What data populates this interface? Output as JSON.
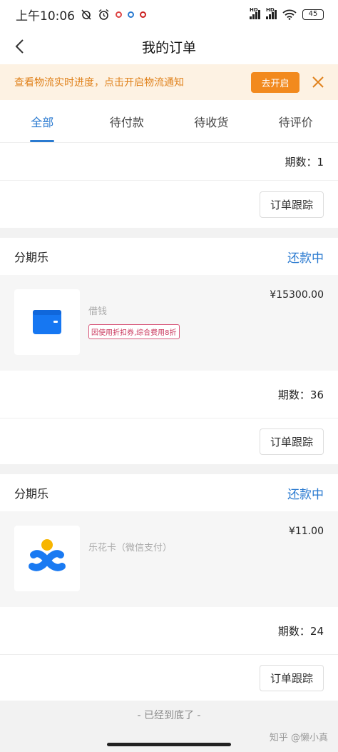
{
  "status_bar": {
    "time": "上午10:06",
    "battery": "45",
    "signal_badges": [
      "HD",
      "HD"
    ]
  },
  "nav": {
    "title": "我的订单",
    "back_icon": "chevron-left-icon"
  },
  "notice": {
    "text": "查看物流实时进度，点击开启物流通知",
    "button_label": "去开启",
    "close_icon": "close-icon"
  },
  "tabs": [
    {
      "label": "全部",
      "active": true
    },
    {
      "label": "待付款",
      "active": false
    },
    {
      "label": "待收货",
      "active": false
    },
    {
      "label": "待评价",
      "active": false
    }
  ],
  "partial_order": {
    "installments": "期数：1",
    "track_button": "订单跟踪"
  },
  "orders": [
    {
      "title": "分期乐",
      "status": "还款中",
      "item_name": "借钱",
      "price": "¥15300.00",
      "promo": "因使用折扣券,综合费用8折",
      "thumb_icon": "wallet-icon",
      "installments": "期数：36",
      "track_button": "订单跟踪"
    },
    {
      "title": "分期乐",
      "status": "还款中",
      "item_name": "乐花卡（微信支付）",
      "price": "¥11.00",
      "promo": "",
      "thumb_icon": "lehua-card-icon",
      "installments": "期数：24",
      "track_button": "订单跟踪"
    }
  ],
  "footer": {
    "end_text": "- 已经到底了 -",
    "watermark": "知乎 @懒小真"
  },
  "colors": {
    "accent": "#2a7ad0",
    "notice_bg": "#fdf2e3",
    "notice_text": "#e0821c",
    "notice_button": "#f28a1e",
    "promo": "#c9375c"
  }
}
